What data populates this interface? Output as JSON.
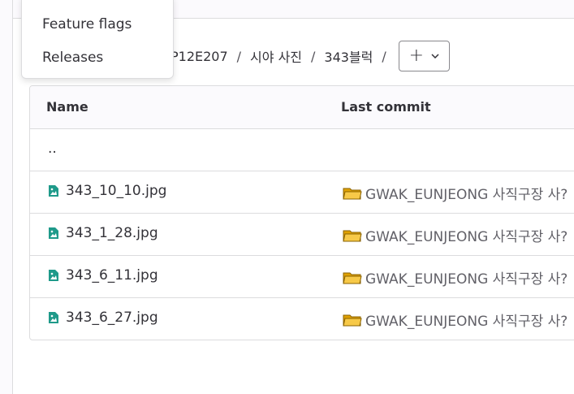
{
  "breadcrumb": {
    "items": [
      "P12E207",
      "시야 사진",
      "343블럭"
    ],
    "separator": "/",
    "add_button": {
      "plus": "+",
      "chevron": "⌄"
    }
  },
  "table": {
    "headers": {
      "name": "Name",
      "last_commit": "Last commit"
    },
    "parent_dir": "..",
    "rows": [
      {
        "name": "343_10_10.jpg",
        "commit": "GWAK_EUNJEONG 사직구장 사?"
      },
      {
        "name": "343_1_28.jpg",
        "commit": "GWAK_EUNJEONG 사직구장 사?"
      },
      {
        "name": "343_6_11.jpg",
        "commit": "GWAK_EUNJEONG 사직구장 사?"
      },
      {
        "name": "343_6_27.jpg",
        "commit": "GWAK_EUNJEONG 사직구장 사?"
      }
    ]
  },
  "dropdown": {
    "items": [
      "Feature flags",
      "Releases"
    ]
  },
  "colors": {
    "icon_teal": "#108548",
    "folder_yellow": "#f5b400",
    "border": "#dcdcde"
  }
}
